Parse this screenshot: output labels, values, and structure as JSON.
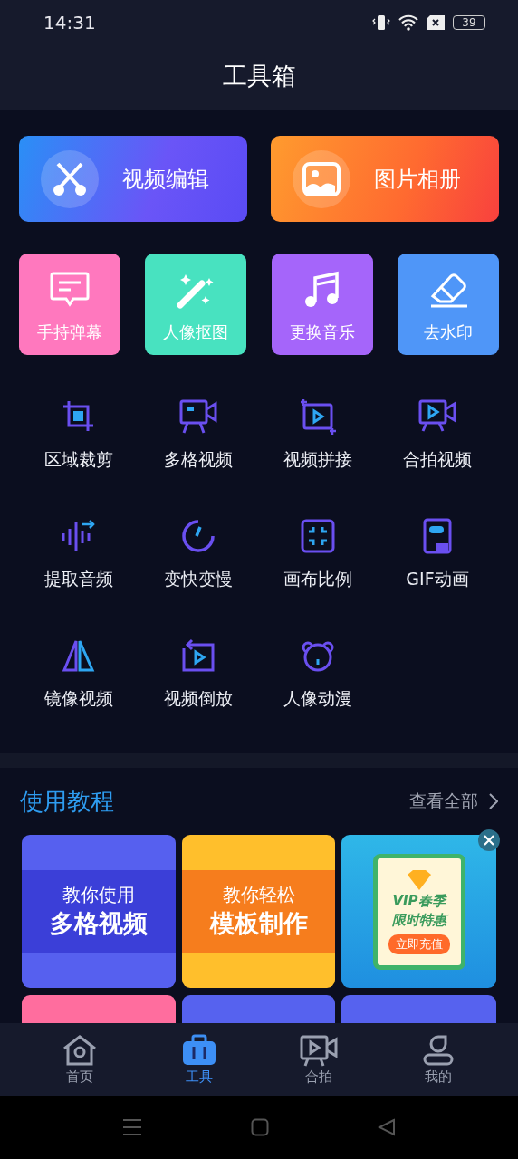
{
  "status_bar": {
    "time": "14:31",
    "battery": "39"
  },
  "title": "工具箱",
  "featured": [
    {
      "label": "视频编辑",
      "kind": "edit"
    },
    {
      "label": "图片相册",
      "kind": "album"
    }
  ],
  "quick_tools": [
    {
      "label": "手持弹幕",
      "color": "#ff78be"
    },
    {
      "label": "人像抠图",
      "color": "#48e2c0"
    },
    {
      "label": "更换音乐",
      "color": "#a565fa"
    },
    {
      "label": "去水印",
      "color": "#4f96f8"
    }
  ],
  "tools": [
    {
      "label": "区域裁剪"
    },
    {
      "label": "多格视频"
    },
    {
      "label": "视频拼接"
    },
    {
      "label": "合拍视频"
    },
    {
      "label": "提取音频"
    },
    {
      "label": "变快变慢"
    },
    {
      "label": "画布比例"
    },
    {
      "label": "GIF动画"
    },
    {
      "label": "镜像视频"
    },
    {
      "label": "视频倒放"
    },
    {
      "label": "人像动漫"
    }
  ],
  "tutorials": {
    "title": "使用教程",
    "more": "查看全部",
    "cards": [
      {
        "kind": "tutorial",
        "line1": "教你使用",
        "line2": "多格视频",
        "color": "#5660ef"
      },
      {
        "kind": "tutorial",
        "line1": "教你轻松",
        "line2": "模板制作",
        "color": "#ffbf2c"
      },
      {
        "kind": "ad",
        "line1": "VIP春季",
        "line2": "限时特惠",
        "button": "立即充值",
        "color": "#2fb7e8"
      },
      {
        "kind": "partial",
        "color": "#ff6d9e"
      },
      {
        "kind": "partial",
        "color": "#5662ef"
      },
      {
        "kind": "partial",
        "color": "#5662ef"
      }
    ]
  },
  "nav": [
    {
      "label": "首页",
      "selected": false
    },
    {
      "label": "工具",
      "selected": true
    },
    {
      "label": "合拍",
      "selected": false
    },
    {
      "label": "我的",
      "selected": false
    }
  ]
}
